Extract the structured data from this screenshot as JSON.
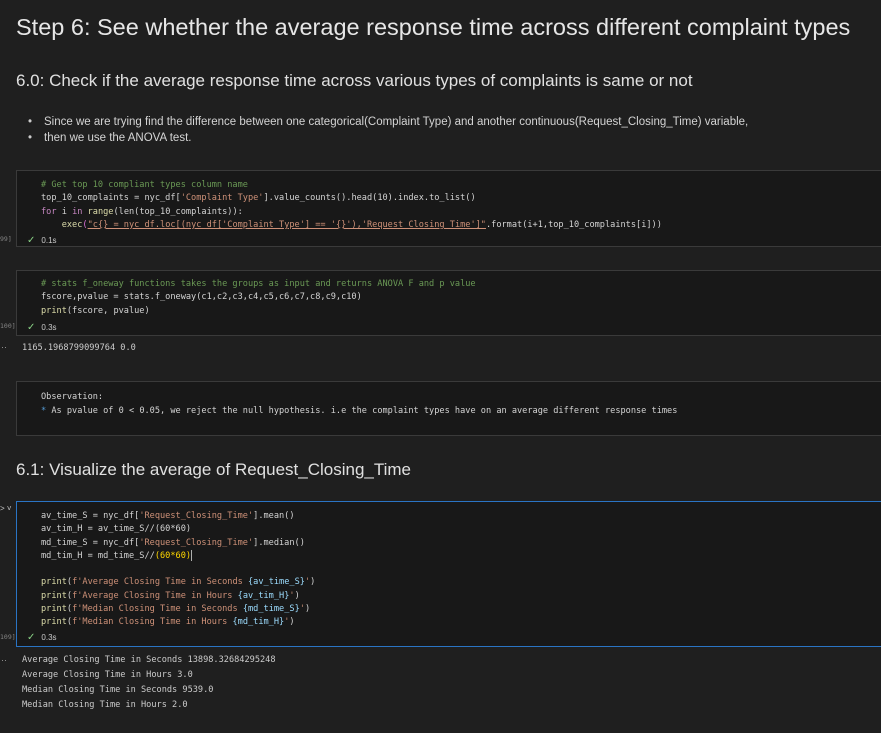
{
  "step_title": "Step 6: See whether the average response time across different complaint types",
  "section_6_0": "6.0: Check if the average response time across various types of complaints is same or not",
  "bullets": [
    "Since we are trying find the difference between one categorical(Complaint Type) and another continuous(Request_Closing_Time) variable,",
    "then we use the ANOVA test."
  ],
  "cell1": {
    "exec_count": "99]",
    "time": "0.1s",
    "comment": "# Get top 10 compliant types column name",
    "line2_a": "top_10_complaints = nyc_df[",
    "line2_str": "'Complaint Type'",
    "line2_b": "].value_counts().head(10).index.to_list()",
    "line3_kw1": "for",
    "line3_a": " i ",
    "line3_kw2": "in",
    "line3_fn": " range",
    "line3_b": "(len(top_10_complaints)):",
    "line4_fn": "exec",
    "line4_str": "\"c{} = nyc_df.loc[(nyc_df['Complaint Type'] == '{}'),'Request_Closing_Time']\"",
    "line4_b": ".format(i+1,top_10_complaints[i]))"
  },
  "cell2": {
    "exec_count": "100]",
    "time": "0.3s",
    "comment": "# stats f_oneway functions takes the groups as input and returns ANOVA F and p value",
    "line2": "fscore,pvalue = stats.f_oneway(c1,c2,c3,c4,c5,c6,c7,c8,c9,c10)",
    "line3_fn": "print",
    "line3_b": "(fscore, pvalue)",
    "output": "1165.1968799099764 0.0"
  },
  "markdown_cell": {
    "line1": "Observation:",
    "bullet": "*",
    "line2": " As pvalue of 0 < 0.05, we reject the null hypothesis. i.e the complaint types have on an average different response times"
  },
  "section_6_1": "6.1: Visualize the average of Request_Closing_Time",
  "cell3": {
    "exec_count": "109]",
    "time": "0.3s",
    "l1_a": "av_time_S = nyc_df[",
    "l1_str": "'Request_Closing_Time'",
    "l1_b": "].mean()",
    "l2": "av_tim_H = av_time_S//(60*60)",
    "l3_a": "md_time_S = nyc_df[",
    "l3_str": "'Request_Closing_Time'",
    "l3_b": "].median()",
    "l4_a": "md_tim_H = md_time_S//",
    "l4_b": "(60*60)",
    "p1_str": "'Average Closing Time in Seconds ",
    "p1_var": "{av_time_S}",
    "p2_str": "'Average Closing Time in Hours ",
    "p2_var": "{av_tim_H}",
    "p3_str": "'Median Closing Time in Seconds ",
    "p3_var": "{md_time_S}",
    "p4_str": "'Median Closing Time in Hours ",
    "p4_var": "{md_tim_H}",
    "print_kw": "print",
    "f_prefix": "f",
    "output": [
      "Average Closing Time in Seconds 13898.32684295248",
      "Average Closing Time in Hours 3.0",
      "Median Closing Time in Seconds 9539.0",
      "Median Closing Time in Hours 2.0"
    ]
  },
  "check_icon": "check-icon",
  "ellipsis": "··",
  "expand_chevron": "> ˅"
}
